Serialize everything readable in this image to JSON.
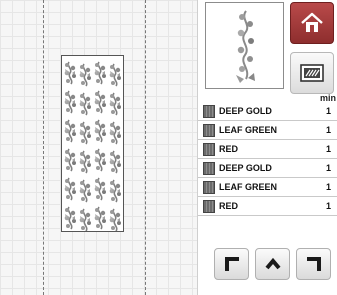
{
  "thread_list": {
    "header": "min",
    "rows": [
      {
        "name": "DEEP GOLD",
        "minutes": "1"
      },
      {
        "name": "LEAF GREEN",
        "minutes": "1"
      },
      {
        "name": "RED",
        "minutes": "1"
      },
      {
        "name": "DEEP GOLD",
        "minutes": "1"
      },
      {
        "name": "LEAF GREEN",
        "minutes": "1"
      },
      {
        "name": "RED",
        "minutes": "1"
      }
    ]
  },
  "icons": {
    "home": "home-icon",
    "stitch_view": "stitch-view-icon",
    "move_up_left": "arrow-up-left-icon",
    "move_up": "arrow-up-icon",
    "move_up_right": "arrow-up-right-icon"
  },
  "colors": {
    "home_button": "#a33b3b",
    "swatch": "#7a7a7a",
    "design_stroke": "#8a8a8a"
  }
}
